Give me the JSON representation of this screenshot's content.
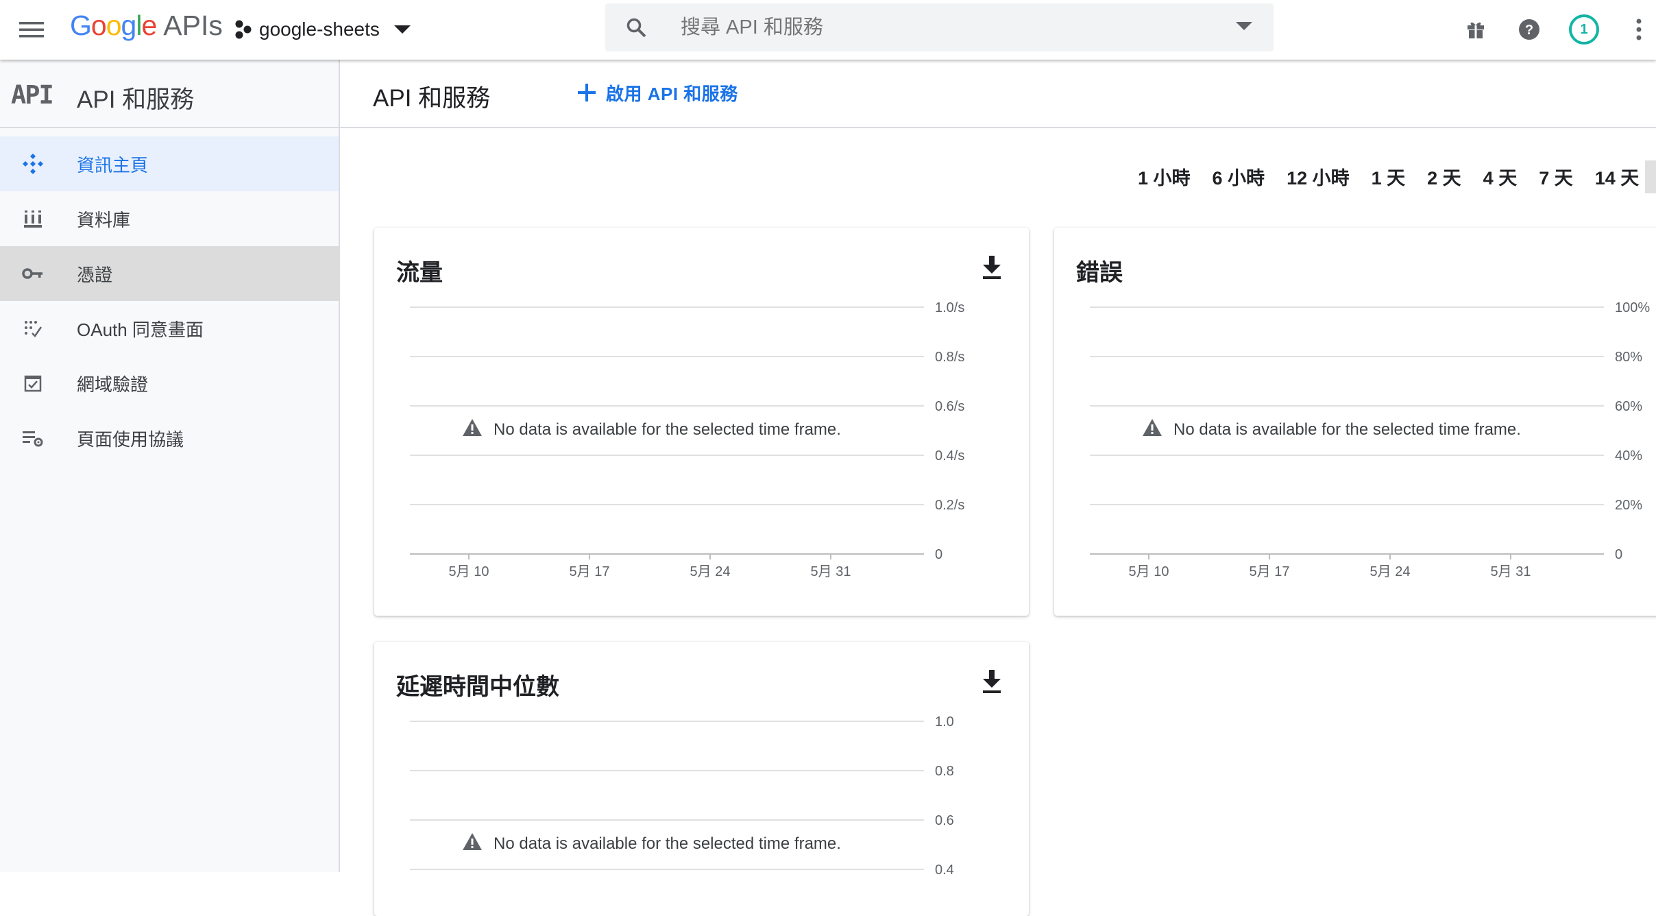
{
  "topbar": {
    "logo_google": "Google",
    "logo_apis": "APIs",
    "project_name": "google-sheets",
    "search_placeholder": "搜尋 API 和服務",
    "notification_count": "1"
  },
  "sidebar": {
    "badge": "API",
    "title": "API 和服務",
    "items": [
      {
        "label": "資訊主頁",
        "icon": "dashboard-icon",
        "state": "active"
      },
      {
        "label": "資料庫",
        "icon": "library-icon",
        "state": "normal"
      },
      {
        "label": "憑證",
        "icon": "key-icon",
        "state": "hover"
      },
      {
        "label": "OAuth 同意畫面",
        "icon": "oauth-consent-icon",
        "state": "normal"
      },
      {
        "label": "網域驗證",
        "icon": "domain-verification-icon",
        "state": "normal"
      },
      {
        "label": "頁面使用協議",
        "icon": "page-usage-icon",
        "state": "normal"
      }
    ]
  },
  "main": {
    "title": "API 和服務",
    "enable_label": "啟用 API 和服務",
    "time_ranges": [
      "1 小時",
      "6 小時",
      "12 小時",
      "1 天",
      "2 天",
      "4 天",
      "7 天",
      "14 天"
    ]
  },
  "no_data_message": "No data is available for the selected time frame.",
  "chart_data": [
    {
      "type": "line",
      "title": "流量",
      "series": [],
      "x_tick_labels": [
        "5月 10",
        "5月 17",
        "5月 24",
        "5月 31"
      ],
      "y_tick_labels": [
        "1.0/s",
        "0.8/s",
        "0.6/s",
        "0.4/s",
        "0.2/s",
        "0"
      ],
      "ylim": [
        0,
        1.0
      ],
      "grid": true
    },
    {
      "type": "line",
      "title": "錯誤",
      "series": [],
      "x_tick_labels": [
        "5月 10",
        "5月 17",
        "5月 24",
        "5月 31"
      ],
      "y_tick_labels": [
        "100%",
        "80%",
        "60%",
        "40%",
        "20%",
        "0"
      ],
      "ylim": [
        0,
        100
      ],
      "grid": true
    },
    {
      "type": "line",
      "title": "延遲時間中位數",
      "series": [],
      "x_tick_labels": [],
      "y_tick_labels": [
        "1.0",
        "0.8",
        "0.6",
        "0.4"
      ],
      "ylim": [
        0,
        1.0
      ],
      "grid": true
    }
  ],
  "colors": {
    "accent": "#1a73e8",
    "active_bg": "#e8f0fe",
    "hover_bg": "#dcdcdc",
    "avatar_ring": "#12b5a5"
  }
}
